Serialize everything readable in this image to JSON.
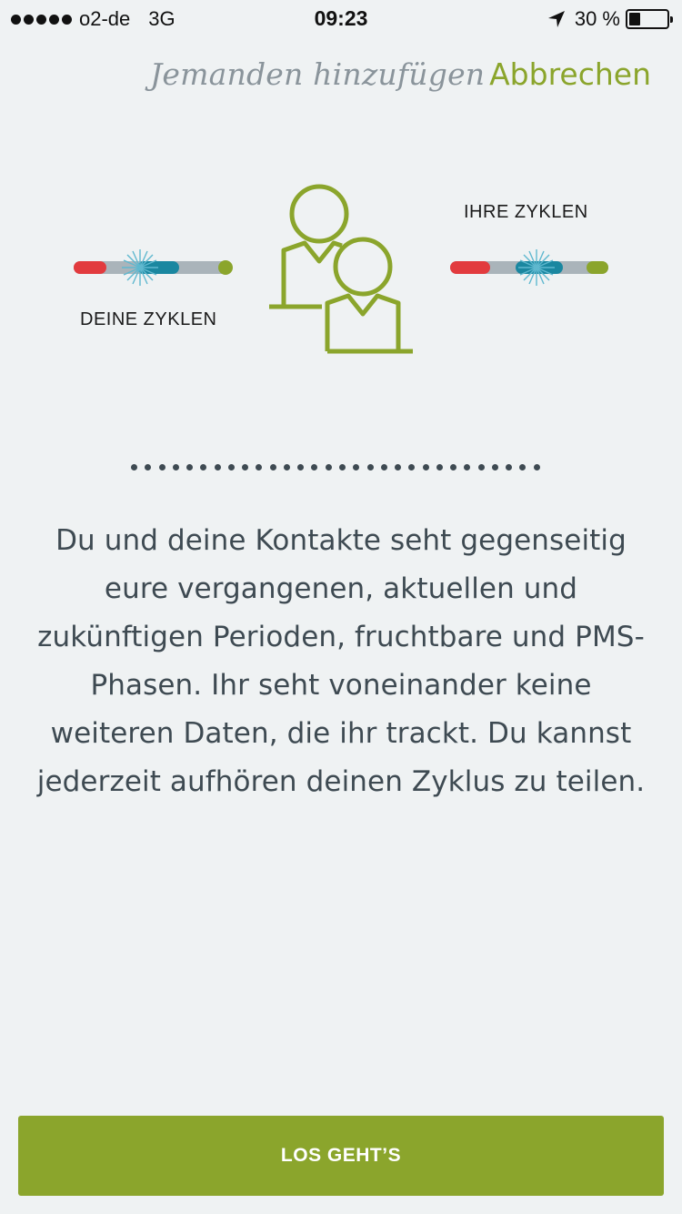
{
  "status_bar": {
    "carrier": "o2-de",
    "network": "3G",
    "time": "09:23",
    "battery_text": "30 %",
    "battery_level": 0.3,
    "icons": [
      "signal-dots-icon",
      "location-arrow-icon",
      "battery-icon"
    ]
  },
  "nav": {
    "title": "Jemanden hinzufügen",
    "cancel_label": "Abbrechen"
  },
  "illustration": {
    "left_label": "DEINE ZYKLEN",
    "right_label": "IHRE ZYKLEN",
    "icon": "two-people-icon"
  },
  "description": "Du und deine Kontakte seht gegenseitig eure vergangenen, aktuellen und zukünftigen Perioden, fruchtbare und PMS-Phasen. Ihr seht voneinander keine weiteren Daten, die ihr trackt. Du kannst jederzeit aufhören deinen Zyklus zu teilen.",
  "cta": {
    "label": "LOS GEHT’S"
  },
  "colors": {
    "accent": "#8ba52c",
    "background": "#eff2f3",
    "text": "#3e4a52",
    "period_red": "#e23b3e",
    "fertile_teal": "#1a87a0",
    "bar_gray": "#aab4ba"
  }
}
